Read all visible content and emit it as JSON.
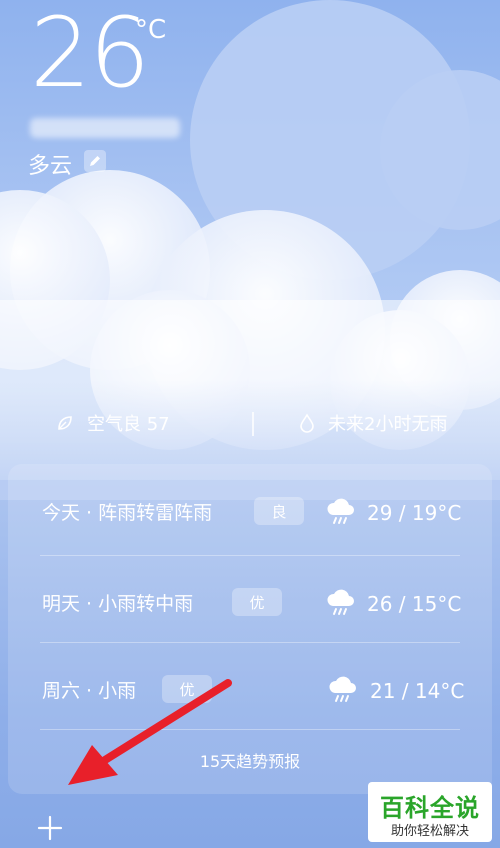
{
  "current": {
    "temperature": "26",
    "unit": "°C",
    "condition": "多云"
  },
  "info": {
    "air_quality": "空气良 57",
    "rain_forecast": "未来2小时无雨"
  },
  "forecast": [
    {
      "label": "今天 · 阵雨转雷阵雨",
      "aqi_badge": "良",
      "range": "29 / 19°C",
      "icon": "cloud-rain-icon"
    },
    {
      "label": "明天 · 小雨转中雨",
      "aqi_badge": "优",
      "range": "26 / 15°C",
      "icon": "cloud-rain-icon"
    },
    {
      "label": "周六 · 小雨",
      "aqi_badge": "优",
      "range": "21 / 14°C",
      "icon": "cloud-rain-icon"
    }
  ],
  "trend_link": "15天趋势预报",
  "watermark": {
    "title": "百科全说",
    "subtitle": "助你轻松解决"
  },
  "colors": {
    "sky_top": "#8fb2ee",
    "sky_bottom": "#86a8e6",
    "arrow": "#e8202a",
    "watermark_green": "#2aa52a"
  }
}
